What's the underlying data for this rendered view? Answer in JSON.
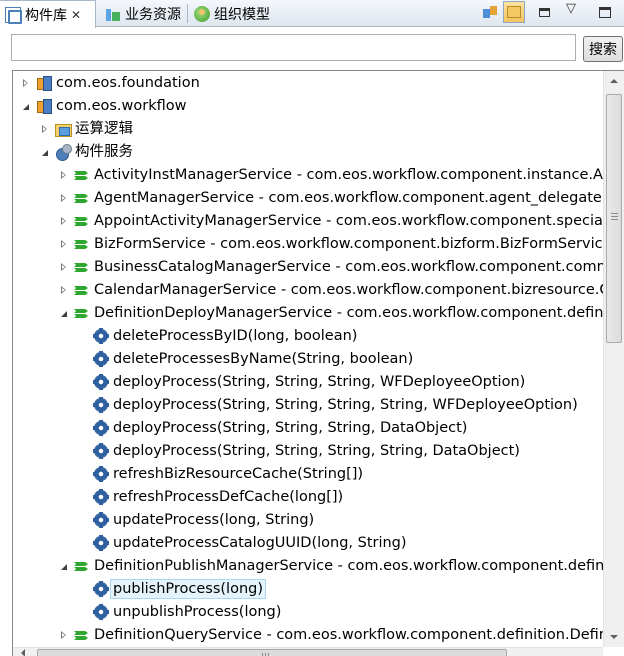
{
  "tabs": [
    {
      "label": "构件库",
      "icon": "component-library-icon",
      "active": true,
      "close_glyph": "✕"
    },
    {
      "label": "业务资源",
      "icon": "business-resource-icon",
      "active": false
    },
    {
      "label": "组织模型",
      "icon": "organization-model-icon",
      "active": false
    }
  ],
  "toolbar_icons": [
    "link-with-editor-icon",
    "show-folder-icon",
    "minimize-icon",
    "maximize-icon"
  ],
  "view_menu_glyph": "▽",
  "search": {
    "value": "",
    "placeholder": "",
    "button_label": "搜索"
  },
  "tree": [
    {
      "label": "com.eos.foundation",
      "icon": "package-icon",
      "expand": "collapsed"
    },
    {
      "label": "com.eos.workflow",
      "icon": "package-icon",
      "expand": "expanded"
    },
    {
      "label": "运算逻辑",
      "icon": "logic-folder-icon",
      "expand": "collapsed"
    },
    {
      "label": "构件服务",
      "icon": "component-service-icon",
      "expand": "expanded"
    },
    {
      "label": "ActivityInstManagerService - com.eos.workflow.component.instance.ActivityInstManagerService",
      "icon": "component-icon",
      "expand": "collapsed"
    },
    {
      "label": "AgentManagerService - com.eos.workflow.component.agent_delegate.AgentManagerService",
      "icon": "component-icon",
      "expand": "collapsed"
    },
    {
      "label": "AppointActivityManagerService - com.eos.workflow.component.special.AppointActivityManagerService",
      "icon": "component-icon",
      "expand": "collapsed"
    },
    {
      "label": "BizFormService - com.eos.workflow.component.bizform.BizFormService",
      "icon": "component-icon",
      "expand": "collapsed"
    },
    {
      "label": "BusinessCatalogManagerService - com.eos.workflow.component.common.BusinessCatalogManagerService",
      "icon": "component-icon",
      "expand": "collapsed"
    },
    {
      "label": "CalendarManagerService - com.eos.workflow.component.bizresource.CalendarManagerService",
      "icon": "component-icon",
      "expand": "collapsed"
    },
    {
      "label": "DefinitionDeployManagerService - com.eos.workflow.component.definition.DefinitionDeployManagerService",
      "icon": "component-icon",
      "expand": "expanded"
    },
    {
      "label": "deleteProcessByID(long, boolean)",
      "icon": "method-icon",
      "expand": "none"
    },
    {
      "label": "deleteProcessesByName(String, boolean)",
      "icon": "method-icon",
      "expand": "none"
    },
    {
      "label": "deployProcess(String, String, String, WFDeployeeOption)",
      "icon": "method-icon",
      "expand": "none"
    },
    {
      "label": "deployProcess(String, String, String, String, WFDeployeeOption)",
      "icon": "method-icon",
      "expand": "none"
    },
    {
      "label": "deployProcess(String, String, String, DataObject)",
      "icon": "method-icon",
      "expand": "none"
    },
    {
      "label": "deployProcess(String, String, String, String, DataObject)",
      "icon": "method-icon",
      "expand": "none"
    },
    {
      "label": "refreshBizResourceCache(String[])",
      "icon": "method-icon",
      "expand": "none"
    },
    {
      "label": "refreshProcessDefCache(long[])",
      "icon": "method-icon",
      "expand": "none"
    },
    {
      "label": "updateProcess(long, String)",
      "icon": "method-icon",
      "expand": "none"
    },
    {
      "label": "updateProcessCatalogUUID(long, String)",
      "icon": "method-icon",
      "expand": "none"
    },
    {
      "label": "DefinitionPublishManagerService - com.eos.workflow.component.definition.DefinitionPublishManagerService",
      "icon": "component-icon",
      "expand": "expanded"
    },
    {
      "label": "publishProcess(long)",
      "icon": "method-icon",
      "expand": "none",
      "selected": true
    },
    {
      "label": "unpublishProcess(long)",
      "icon": "method-icon",
      "expand": "none"
    },
    {
      "label": "DefinitionQueryService - com.eos.workflow.component.definition.DefinitionQueryService",
      "icon": "component-icon",
      "expand": "collapsed"
    }
  ],
  "vertical_scroll_position": 0.0
}
